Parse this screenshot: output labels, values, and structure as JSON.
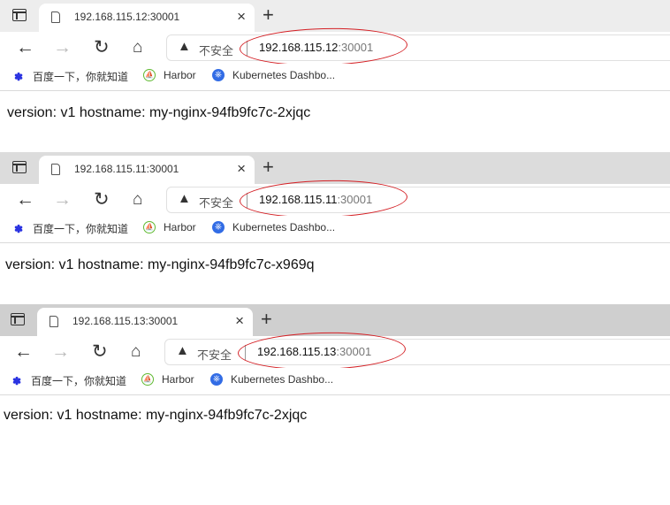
{
  "windows": [
    {
      "tab": {
        "title": "192.168.115.12:30001"
      },
      "address": {
        "security": "不安全",
        "host": "192.168.115.12",
        "port": ":30001"
      },
      "bookmarks": [
        "百度一下，你就知道",
        "Harbor",
        "Kubernetes Dashbo..."
      ],
      "content": "version: v1 hostname: my-nginx-94fb9fc7c-2xjqc"
    },
    {
      "tab": {
        "title": "192.168.115.11:30001"
      },
      "address": {
        "security": "不安全",
        "host": "192.168.115.11",
        "port": ":30001"
      },
      "bookmarks": [
        "百度一下，你就知道",
        "Harbor",
        "Kubernetes Dashbo..."
      ],
      "content": "version: v1 hostname: my-nginx-94fb9fc7c-x969q"
    },
    {
      "tab": {
        "title": "192.168.115.13:30001"
      },
      "address": {
        "security": "不安全",
        "host": "192.168.115.13",
        "port": ":30001"
      },
      "bookmarks": [
        "百度一下，你就知道",
        "Harbor",
        "Kubernetes Dashbo..."
      ],
      "content": "version: v1 hostname: my-nginx-94fb9fc7c-2xjqc"
    }
  ],
  "icons": {
    "tab_actions": "tab-actions-icon",
    "page": "page-icon",
    "close": "close-icon",
    "new_tab": "plus-icon",
    "back": "back-arrow-icon",
    "forward": "forward-arrow-icon",
    "reload": "reload-icon",
    "home": "home-icon",
    "warning": "warning-triangle-icon"
  },
  "colors": {
    "annotation_ring": "#d42025",
    "kubernetes": "#326ce5",
    "baidu": "#2932e1"
  }
}
